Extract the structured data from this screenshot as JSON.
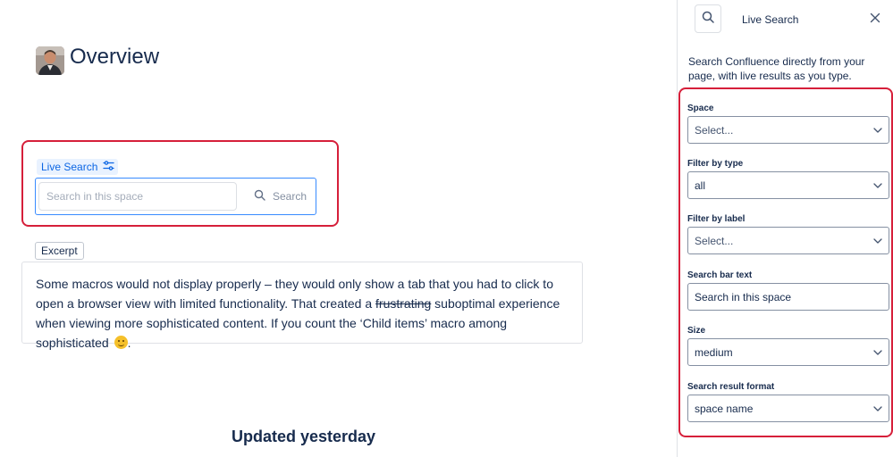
{
  "page": {
    "title": "Overview",
    "footer_text": "Updated yesterday"
  },
  "macro": {
    "chip_label": "Live Search",
    "input_placeholder": "Search in this space",
    "search_button_label": "Search"
  },
  "excerpt": {
    "tag_label": "Excerpt",
    "text_part1": "Some macros would not display properly – they would only show a tab that you had to click to open a browser view with limited functionality. That created a ",
    "strikethrough": "frustrating",
    "text_part2": " suboptimal experience when viewing more sophisticated content. If you count the ‘Child items’ macro among sophisticated ",
    "text_end": "."
  },
  "panel": {
    "title": "Live Search",
    "description": "Search Confluence directly from your page, with live results as you type.",
    "fields": {
      "space": {
        "label": "Space",
        "value": "Select..."
      },
      "filter_type": {
        "label": "Filter by type",
        "value": "all"
      },
      "filter_label": {
        "label": "Filter by label",
        "value": "Select..."
      },
      "search_bar_text": {
        "label": "Search bar text",
        "value": "Search in this space"
      },
      "size": {
        "label": "Size",
        "value": "medium"
      },
      "result_format": {
        "label": "Search result format",
        "value": "space name"
      }
    }
  },
  "colors": {
    "highlight": "#d61f3a",
    "accent": "#0c66e4",
    "input_focus": "#388bff"
  },
  "icons": [
    "search-icon",
    "close-icon",
    "chevron-down-icon",
    "settings-sliders-icon",
    "smiley-icon"
  ]
}
